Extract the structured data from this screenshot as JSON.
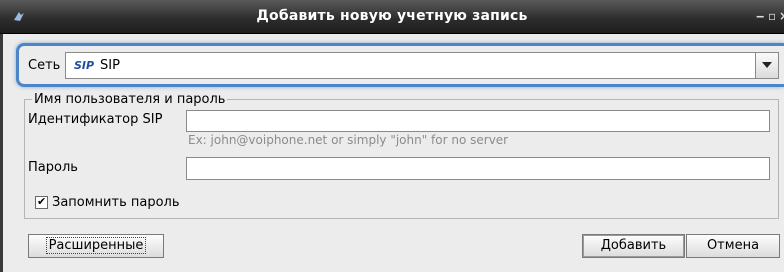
{
  "window": {
    "title": "Добавить новую учетную запись",
    "app_icon": "app-logo-icon",
    "controls": {
      "minimize": "‒",
      "maximize": "▫",
      "close": "×"
    }
  },
  "network": {
    "label": "Сеть",
    "logo_text": "SIP",
    "selected": "SIP",
    "dropdown_icon": "chevron-down-icon"
  },
  "credentials": {
    "group_title": "Имя пользователя и пароль",
    "sip_id_label": "Идентификатор SIP",
    "sip_id_value": "",
    "sip_id_hint": "Ex: john@voiphone.net or simply \"john\" for no server",
    "password_label": "Пароль",
    "password_value": "",
    "remember_label": "Запомнить пароль",
    "remember_checked": true,
    "check_mark": "✔"
  },
  "buttons": {
    "advanced": "Расширенные",
    "add": "Добавить",
    "cancel": "Отмена"
  },
  "colors": {
    "focus_highlight": "#4c86c6",
    "titlebar": "#2e2e2e",
    "background": "#ececec"
  }
}
